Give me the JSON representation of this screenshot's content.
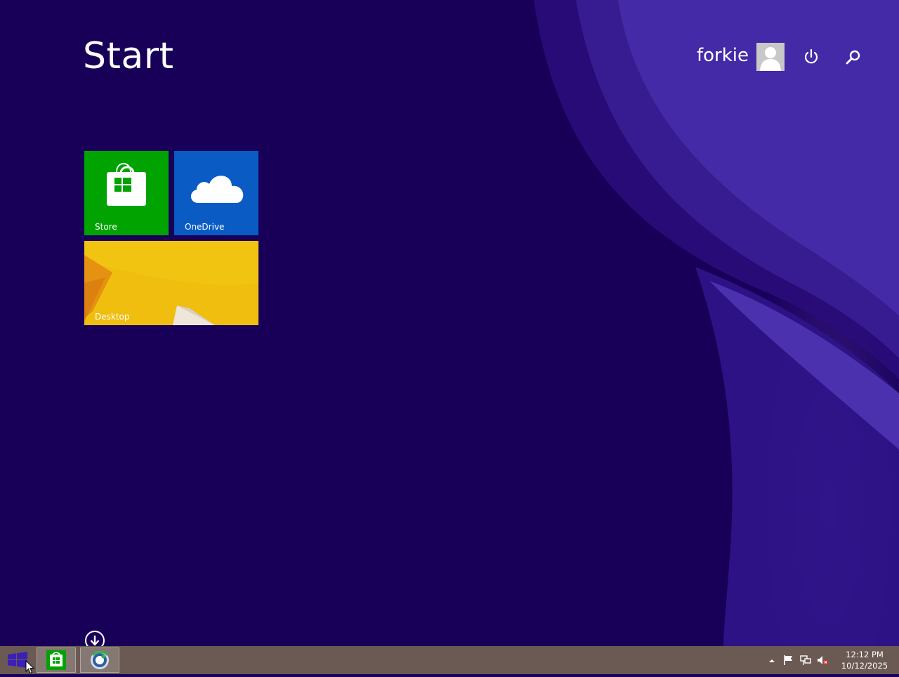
{
  "header": {
    "title": "Start",
    "user_name": "forkie"
  },
  "tiles": [
    {
      "label": "Store",
      "color": "#00a300",
      "icon": "store-bag-icon"
    },
    {
      "label": "OneDrive",
      "color": "#0a5bc4",
      "icon": "cloud-icon"
    },
    {
      "label": "Desktop",
      "color": "#e9b20a",
      "icon": "desktop-wallpaper"
    }
  ],
  "taskbar": {
    "time": "12:12 PM",
    "date": "10/12/2025",
    "pinned": [
      "store-icon",
      "internet-explorer-icon"
    ],
    "tray_icons": [
      "show-hidden-icons-arrow",
      "action-center-flag-icon",
      "network-icon",
      "volume-muted-icon"
    ]
  },
  "colors": {
    "background": "#180059",
    "taskbar": "#6b5a53",
    "accent_purple": "#4a2fa8"
  }
}
